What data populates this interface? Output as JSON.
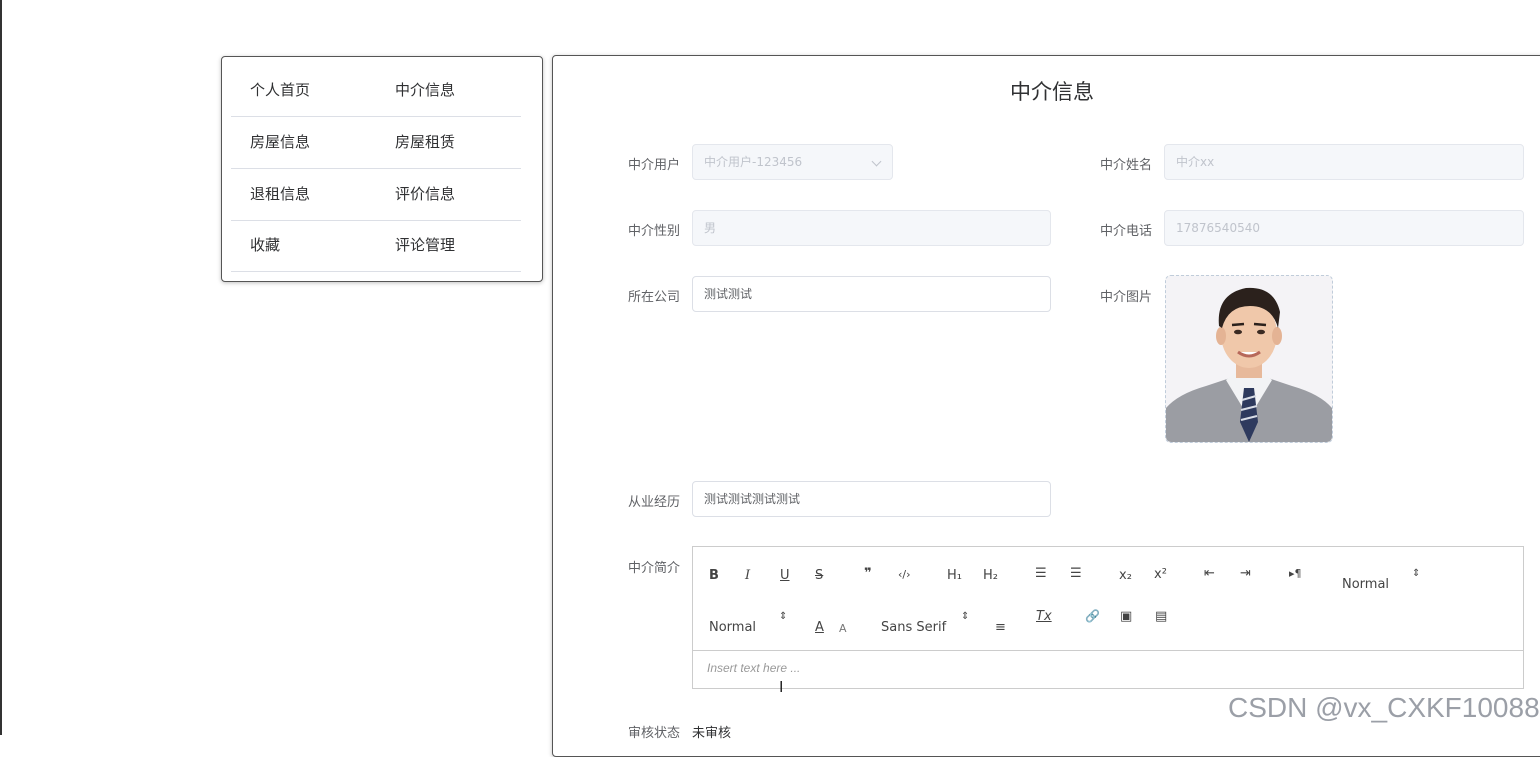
{
  "menu": {
    "rows": [
      {
        "left": "个人首页",
        "right": "中介信息"
      },
      {
        "left": "房屋信息",
        "right": "房屋租赁"
      },
      {
        "left": "退租信息",
        "right": "评价信息"
      },
      {
        "left": "收藏",
        "right": "评论管理"
      }
    ]
  },
  "form": {
    "title": "中介信息",
    "agent_user": {
      "label": "中介用户",
      "placeholder": "中介用户-123456"
    },
    "agent_name": {
      "label": "中介姓名",
      "placeholder": "中介xx"
    },
    "agent_gender": {
      "label": "中介性别",
      "placeholder": "男"
    },
    "agent_phone": {
      "label": "中介电话",
      "placeholder": "17876540540"
    },
    "company": {
      "label": "所在公司",
      "value": "测试测试"
    },
    "photo": {
      "label": "中介图片"
    },
    "experience": {
      "label": "从业经历",
      "value": "测试测试测试测试"
    },
    "intro": {
      "label": "中介简介",
      "placeholder": "Insert text here ..."
    },
    "review_status": {
      "label": "审核状态",
      "value": "未审核"
    }
  },
  "editor_toolbar": {
    "bold": "B",
    "italic": "I",
    "underline": "U",
    "strike": "S",
    "blockquote": "❞",
    "code": "‹/›",
    "h1": "H₁",
    "h2": "H₂",
    "ordered_list": "☰",
    "bullet_list": "☰",
    "subscript": "x₂",
    "superscript": "x²",
    "indent_dec": "⇤",
    "indent_inc": "⇥",
    "direction": "▸¶",
    "header_select": "Normal",
    "size_select": "Normal",
    "color": "A",
    "background": "A",
    "font_select": "Sans Serif",
    "align": "≡",
    "clean": "Tx",
    "link": "🔗",
    "image": "▣",
    "video": "▤"
  },
  "watermark": "CSDN @vx_CXKF10088"
}
